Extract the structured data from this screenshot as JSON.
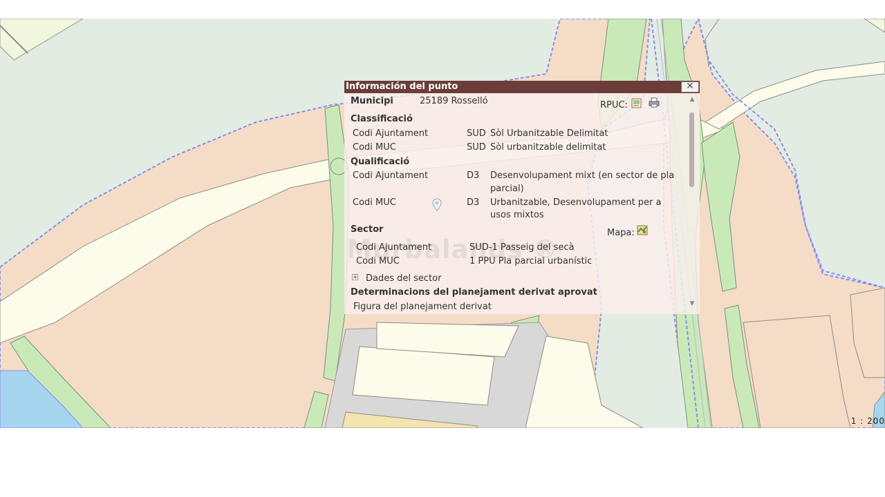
{
  "popup": {
    "title": "Información del punto",
    "close_label": "✕",
    "municipi_label": "Municipi",
    "municipi_value": "25189 Rosselló",
    "rpuc_label": "RPUC:",
    "classificacio": {
      "heading": "Classificació",
      "rows": [
        {
          "label": "Codi Ajuntament",
          "code": "SUD",
          "desc": "Sòl Urbanitzable Delimitat"
        },
        {
          "label": "Codi MUC",
          "code": "SUD",
          "desc": "Sòl urbanitzable delimitat"
        }
      ]
    },
    "qualificacio": {
      "heading": "Qualificació",
      "rows": [
        {
          "label": "Codi Ajuntament",
          "code": "D3",
          "desc1": "Desenvolupament mixt (en sector de pla",
          "desc2": "parcial)"
        },
        {
          "label": "Codi MUC",
          "code": "D3",
          "desc1": "Urbanitzable, Desenvolupament per a",
          "desc2": "usos mixtos"
        }
      ]
    },
    "sector": {
      "heading": "Sector",
      "mapa_label": "Mapa:",
      "rows": [
        {
          "label": "Codi Ajuntament",
          "value": "SUD-1 Passeig del secà"
        },
        {
          "label": "Codi MUC",
          "value": "1 PPU Pla parcial urbanístic"
        }
      ],
      "expand_label": "Dades del sector"
    },
    "determinacions": {
      "heading": "Determinacions del planejament derivat aprovat",
      "first_row": "Figura del planejament derivat"
    }
  },
  "watermark": "Murbalands ®",
  "scale_text": "1 : 200",
  "icons": {
    "rpuc_doc": "document-map-icon",
    "rpuc_print": "printer-icon",
    "sector_map": "map-icon",
    "location": "location-pin-icon",
    "expand": "plus-expand-icon"
  },
  "colors": {
    "title_bar": "#6b3c38",
    "popup_bg": "#f9eeec",
    "urbanizable": "#f4dcc6",
    "green_zone": "#c9eab8",
    "road": "#fdfbe9",
    "boundary": "#8a8cf0",
    "water": "#a6d5f0"
  }
}
